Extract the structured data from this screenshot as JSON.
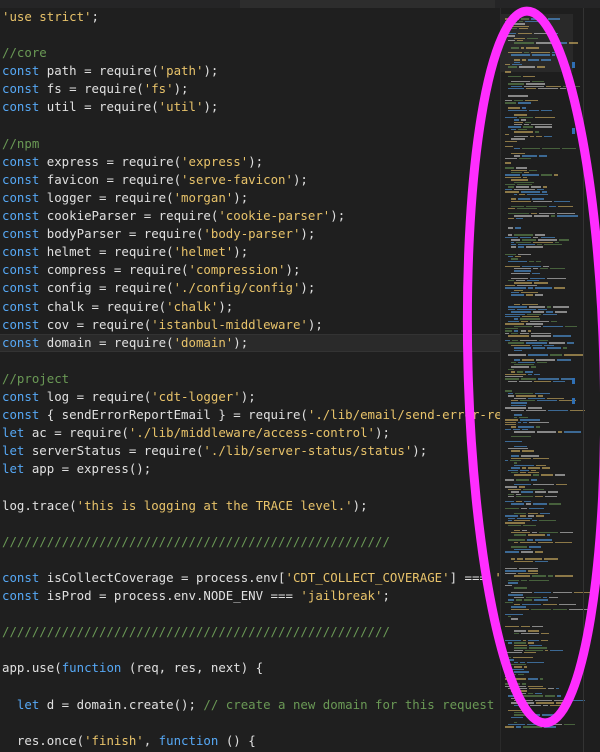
{
  "colors": {
    "keyword": "#56a8f5",
    "string": "#e8c36a",
    "comment": "#6a9955",
    "text": "#e0e0e0",
    "background": "#1f1f1f",
    "annotation": "#ff2dff"
  },
  "editor": {
    "current_line": 18,
    "lines": [
      [
        {
          "t": "str",
          "v": "'use strict'"
        },
        {
          "t": "txt",
          "v": ";"
        }
      ],
      [],
      [
        {
          "t": "cmt",
          "v": "//core"
        }
      ],
      [
        {
          "t": "kw",
          "v": "const "
        },
        {
          "t": "txt",
          "v": "path = require("
        },
        {
          "t": "str",
          "v": "'path'"
        },
        {
          "t": "txt",
          "v": ");"
        }
      ],
      [
        {
          "t": "kw",
          "v": "const "
        },
        {
          "t": "txt",
          "v": "fs = require("
        },
        {
          "t": "str",
          "v": "'fs'"
        },
        {
          "t": "txt",
          "v": ");"
        }
      ],
      [
        {
          "t": "kw",
          "v": "const "
        },
        {
          "t": "txt",
          "v": "util = require("
        },
        {
          "t": "str",
          "v": "'util'"
        },
        {
          "t": "txt",
          "v": ");"
        }
      ],
      [],
      [
        {
          "t": "cmt",
          "v": "//npm"
        }
      ],
      [
        {
          "t": "kw",
          "v": "const "
        },
        {
          "t": "txt",
          "v": "express = require("
        },
        {
          "t": "str",
          "v": "'express'"
        },
        {
          "t": "txt",
          "v": ");"
        }
      ],
      [
        {
          "t": "kw",
          "v": "const "
        },
        {
          "t": "txt",
          "v": "favicon = require("
        },
        {
          "t": "str",
          "v": "'serve-favicon'"
        },
        {
          "t": "txt",
          "v": ");"
        }
      ],
      [
        {
          "t": "kw",
          "v": "const "
        },
        {
          "t": "txt",
          "v": "logger = require("
        },
        {
          "t": "str",
          "v": "'morgan'"
        },
        {
          "t": "txt",
          "v": ");"
        }
      ],
      [
        {
          "t": "kw",
          "v": "const "
        },
        {
          "t": "txt",
          "v": "cookieParser = require("
        },
        {
          "t": "str",
          "v": "'cookie-parser'"
        },
        {
          "t": "txt",
          "v": ");"
        }
      ],
      [
        {
          "t": "kw",
          "v": "const "
        },
        {
          "t": "txt",
          "v": "bodyParser = require("
        },
        {
          "t": "str",
          "v": "'body-parser'"
        },
        {
          "t": "txt",
          "v": ");"
        }
      ],
      [
        {
          "t": "kw",
          "v": "const "
        },
        {
          "t": "txt",
          "v": "helmet = require("
        },
        {
          "t": "str",
          "v": "'helmet'"
        },
        {
          "t": "txt",
          "v": ");"
        }
      ],
      [
        {
          "t": "kw",
          "v": "const "
        },
        {
          "t": "txt",
          "v": "compress = require("
        },
        {
          "t": "str",
          "v": "'compression'"
        },
        {
          "t": "txt",
          "v": ");"
        }
      ],
      [
        {
          "t": "kw",
          "v": "const "
        },
        {
          "t": "txt",
          "v": "config = require("
        },
        {
          "t": "str",
          "v": "'./config/config'"
        },
        {
          "t": "txt",
          "v": ");"
        }
      ],
      [
        {
          "t": "kw",
          "v": "const "
        },
        {
          "t": "txt",
          "v": "chalk = require("
        },
        {
          "t": "str",
          "v": "'chalk'"
        },
        {
          "t": "txt",
          "v": ");"
        }
      ],
      [
        {
          "t": "kw",
          "v": "const "
        },
        {
          "t": "txt",
          "v": "cov = require("
        },
        {
          "t": "str",
          "v": "'istanbul-middleware'"
        },
        {
          "t": "txt",
          "v": ");"
        }
      ],
      [
        {
          "t": "kw",
          "v": "const "
        },
        {
          "t": "txt",
          "v": "domain = require("
        },
        {
          "t": "str",
          "v": "'domain'"
        },
        {
          "t": "txt",
          "v": ");"
        }
      ],
      [],
      [
        {
          "t": "cmt",
          "v": "//project"
        }
      ],
      [
        {
          "t": "kw",
          "v": "const "
        },
        {
          "t": "txt",
          "v": "log = require("
        },
        {
          "t": "str",
          "v": "'cdt-logger'"
        },
        {
          "t": "txt",
          "v": ");"
        }
      ],
      [
        {
          "t": "kw",
          "v": "const "
        },
        {
          "t": "txt",
          "v": "{ sendErrorReportEmail } = require("
        },
        {
          "t": "str",
          "v": "'./lib/email/send-error-repo"
        }
      ],
      [
        {
          "t": "kw",
          "v": "let "
        },
        {
          "t": "txt",
          "v": "ac = require("
        },
        {
          "t": "str",
          "v": "'./lib/middleware/access-control'"
        },
        {
          "t": "txt",
          "v": ");"
        }
      ],
      [
        {
          "t": "kw",
          "v": "let "
        },
        {
          "t": "txt",
          "v": "serverStatus = require("
        },
        {
          "t": "str",
          "v": "'./lib/server-status/status'"
        },
        {
          "t": "txt",
          "v": ");"
        }
      ],
      [
        {
          "t": "kw",
          "v": "let "
        },
        {
          "t": "txt",
          "v": "app = express();"
        }
      ],
      [],
      [
        {
          "t": "txt",
          "v": "log.trace("
        },
        {
          "t": "str",
          "v": "'this is logging at the TRACE level.'"
        },
        {
          "t": "txt",
          "v": ");"
        }
      ],
      [],
      [
        {
          "t": "cmt",
          "v": "////////////////////////////////////////////////////"
        }
      ],
      [],
      [
        {
          "t": "kw",
          "v": "const "
        },
        {
          "t": "txt",
          "v": "isCollectCoverage = process.env["
        },
        {
          "t": "str",
          "v": "'CDT_COLLECT_COVERAGE'"
        },
        {
          "t": "txt",
          "v": "] === "
        },
        {
          "t": "str",
          "v": "'ye"
        }
      ],
      [
        {
          "t": "kw",
          "v": "const "
        },
        {
          "t": "txt",
          "v": "isProd = process.env.NODE_ENV === "
        },
        {
          "t": "str",
          "v": "'jailbreak'"
        },
        {
          "t": "txt",
          "v": ";"
        }
      ],
      [],
      [
        {
          "t": "cmt",
          "v": "////////////////////////////////////////////////////"
        }
      ],
      [],
      [
        {
          "t": "txt",
          "v": "app.use("
        },
        {
          "t": "kw",
          "v": "function "
        },
        {
          "t": "txt",
          "v": "(req, res, next) {"
        }
      ],
      [],
      [
        {
          "t": "txt",
          "v": "  "
        },
        {
          "t": "kw",
          "v": "let "
        },
        {
          "t": "txt",
          "v": "d = domain.create(); "
        },
        {
          "t": "cmt",
          "v": "// create a new domain for this request"
        }
      ],
      [],
      [
        {
          "t": "txt",
          "v": "  res.once("
        },
        {
          "t": "str",
          "v": "'finish'"
        },
        {
          "t": "txt",
          "v": ", "
        },
        {
          "t": "kw",
          "v": "function "
        },
        {
          "t": "txt",
          "v": "() {"
        }
      ]
    ]
  }
}
